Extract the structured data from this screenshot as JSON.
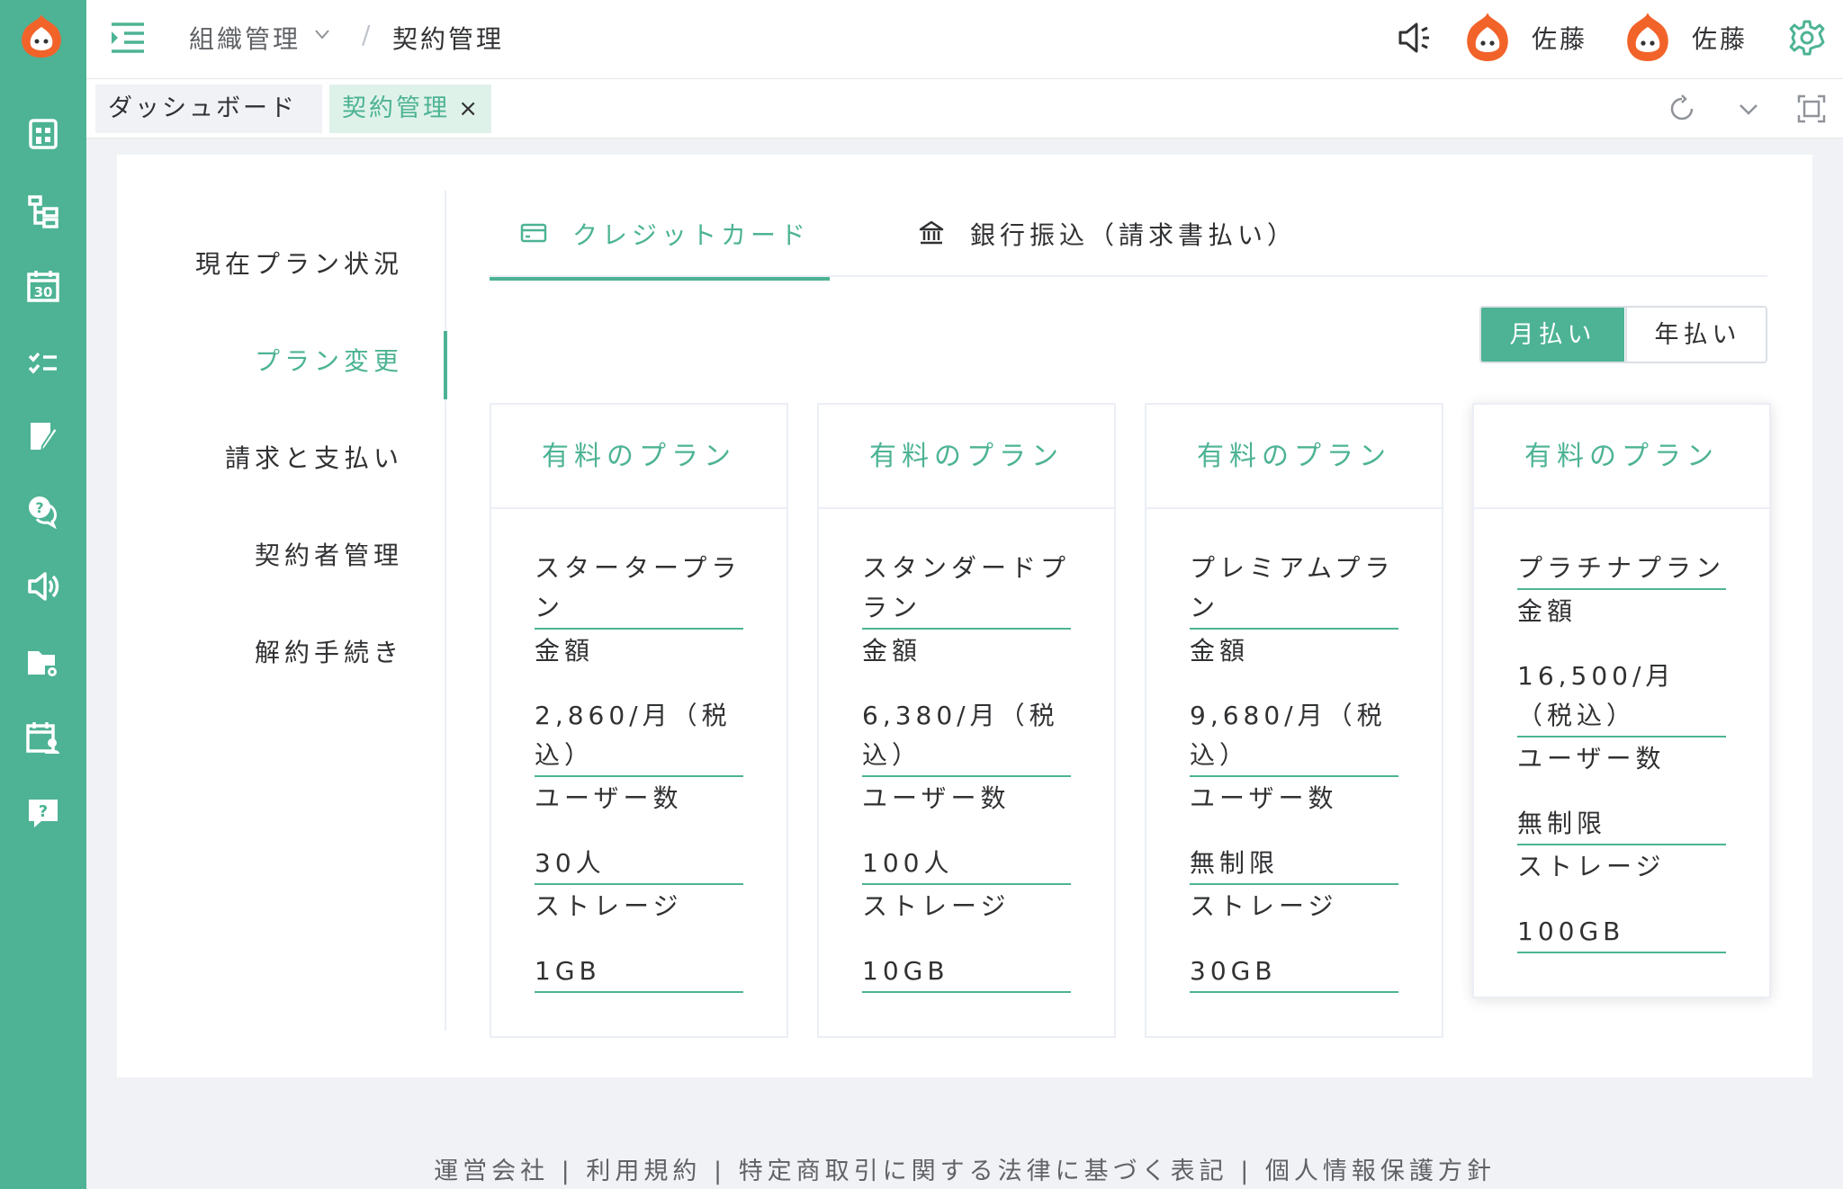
{
  "header": {
    "breadcrumb_parent": "組織管理",
    "breadcrumb_separator": "/",
    "breadcrumb_current": "契約管理",
    "users": [
      "佐藤",
      "佐藤"
    ]
  },
  "tags": {
    "dashboard": "ダッシュボード",
    "active": "契約管理",
    "close": "×"
  },
  "leftnav": {
    "items": [
      "現在プラン状況",
      "プラン変更",
      "請求と支払い",
      "契約者管理",
      "解約手続き"
    ],
    "active_index": 1
  },
  "tabs": {
    "credit": "クレジットカード",
    "bank": "銀行振込（請求書払い）"
  },
  "billing": {
    "monthly": "月払い",
    "yearly": "年払い"
  },
  "plans": [
    {
      "header": "有料のプラン",
      "name": "スタータープラン",
      "price_label": "金額",
      "price": "2,860/月（税込）",
      "users_label": "ユーザー数",
      "users": "30人",
      "storage_label": "ストレージ",
      "storage": "1GB"
    },
    {
      "header": "有料のプラン",
      "name": "スタンダードプラン",
      "price_label": "金額",
      "price": "6,380/月（税込）",
      "users_label": "ユーザー数",
      "users": "100人",
      "storage_label": "ストレージ",
      "storage": "10GB"
    },
    {
      "header": "有料のプラン",
      "name": "プレミアムプラン",
      "price_label": "金額",
      "price": "9,680/月（税込）",
      "users_label": "ユーザー数",
      "users": "無制限",
      "storage_label": "ストレージ",
      "storage": "30GB"
    },
    {
      "header": "有料のプラン",
      "name": "プラチナプラン",
      "price_label": "金額",
      "price": "16,500/月（税込）",
      "users_label": "ユーザー数",
      "users": "無制限",
      "storage_label": "ストレージ",
      "storage": "100GB"
    }
  ],
  "footer": "運営会社 | 利用規約 | 特定商取引に関する法律に基づく表記 | 個人情報保護方針",
  "colors": {
    "accent": "#4db394",
    "avatar": "#f2632a"
  },
  "icons": [
    "logo-icon",
    "building-icon",
    "org-chart-icon",
    "calendar-icon",
    "checklist-icon",
    "edit-doc-icon",
    "chat-help-icon",
    "speaker-icon",
    "folder-settings-icon",
    "schedule-user-icon",
    "help-icon",
    "menu-toggle-icon",
    "megaphone-icon",
    "gear-icon",
    "refresh-icon",
    "chevron-down-icon",
    "fullscreen-icon",
    "card-icon",
    "bank-icon"
  ]
}
